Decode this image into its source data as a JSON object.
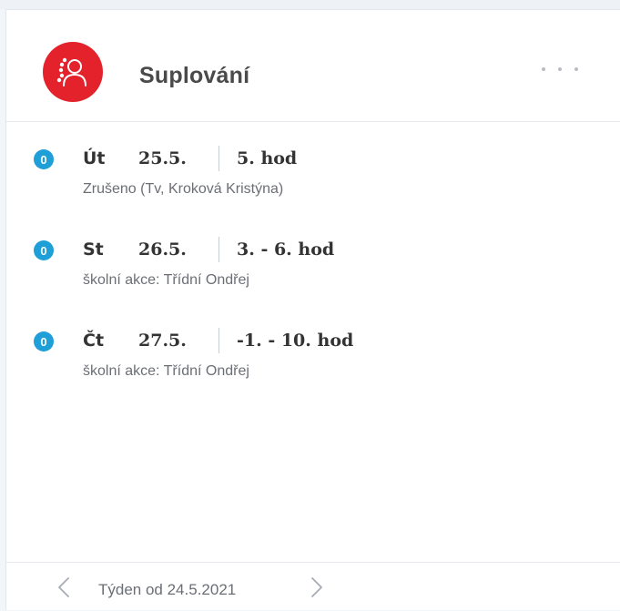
{
  "card": {
    "title": "Suplování",
    "avatar_icon": "person-swap-icon",
    "menu_icon": "more-horizontal-icon",
    "accent_color": "#e3222c",
    "badge_color": "#1e9fd8"
  },
  "items": [
    {
      "badge": "0",
      "day": "Út",
      "date": "25.5.",
      "hour": "5. hod",
      "description": "Zrušeno (Tv, Kroková Kristýna)"
    },
    {
      "badge": "0",
      "day": "St",
      "date": "26.5.",
      "hour": "3. - 6. hod",
      "description": "školní akce: Třídní Ondřej"
    },
    {
      "badge": "0",
      "day": "Čt",
      "date": "27.5.",
      "hour": "-1. - 10. hod",
      "description": "školní akce: Třídní Ondřej"
    }
  ],
  "footer": {
    "week_label": "Týden od 24.5.2021",
    "prev_icon": "chevron-left-icon",
    "next_icon": "chevron-right-icon"
  }
}
